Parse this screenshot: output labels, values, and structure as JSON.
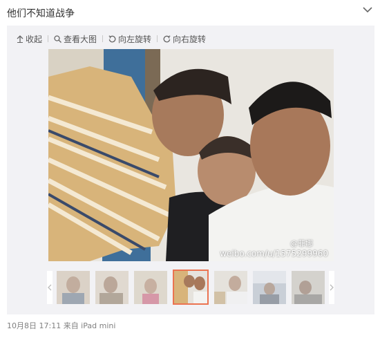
{
  "post": {
    "text": "他们不知道战争",
    "footer": "10月8日 17:11 来自 iPad mini"
  },
  "toolbar": {
    "collapse_label": "收起",
    "view_large_label": "查看大图",
    "rotate_left_label": "向左旋转",
    "rotate_right_label": "向右旋转"
  },
  "photo": {
    "watermark_handle": "@菲娜",
    "watermark_url": "weibo.com/u/1575299960"
  },
  "thumbnails": {
    "count": 7,
    "active_index": 3
  },
  "colors": {
    "panel_bg": "#f2f2f5",
    "active_border": "#eb7350",
    "footer_text": "#808080"
  }
}
